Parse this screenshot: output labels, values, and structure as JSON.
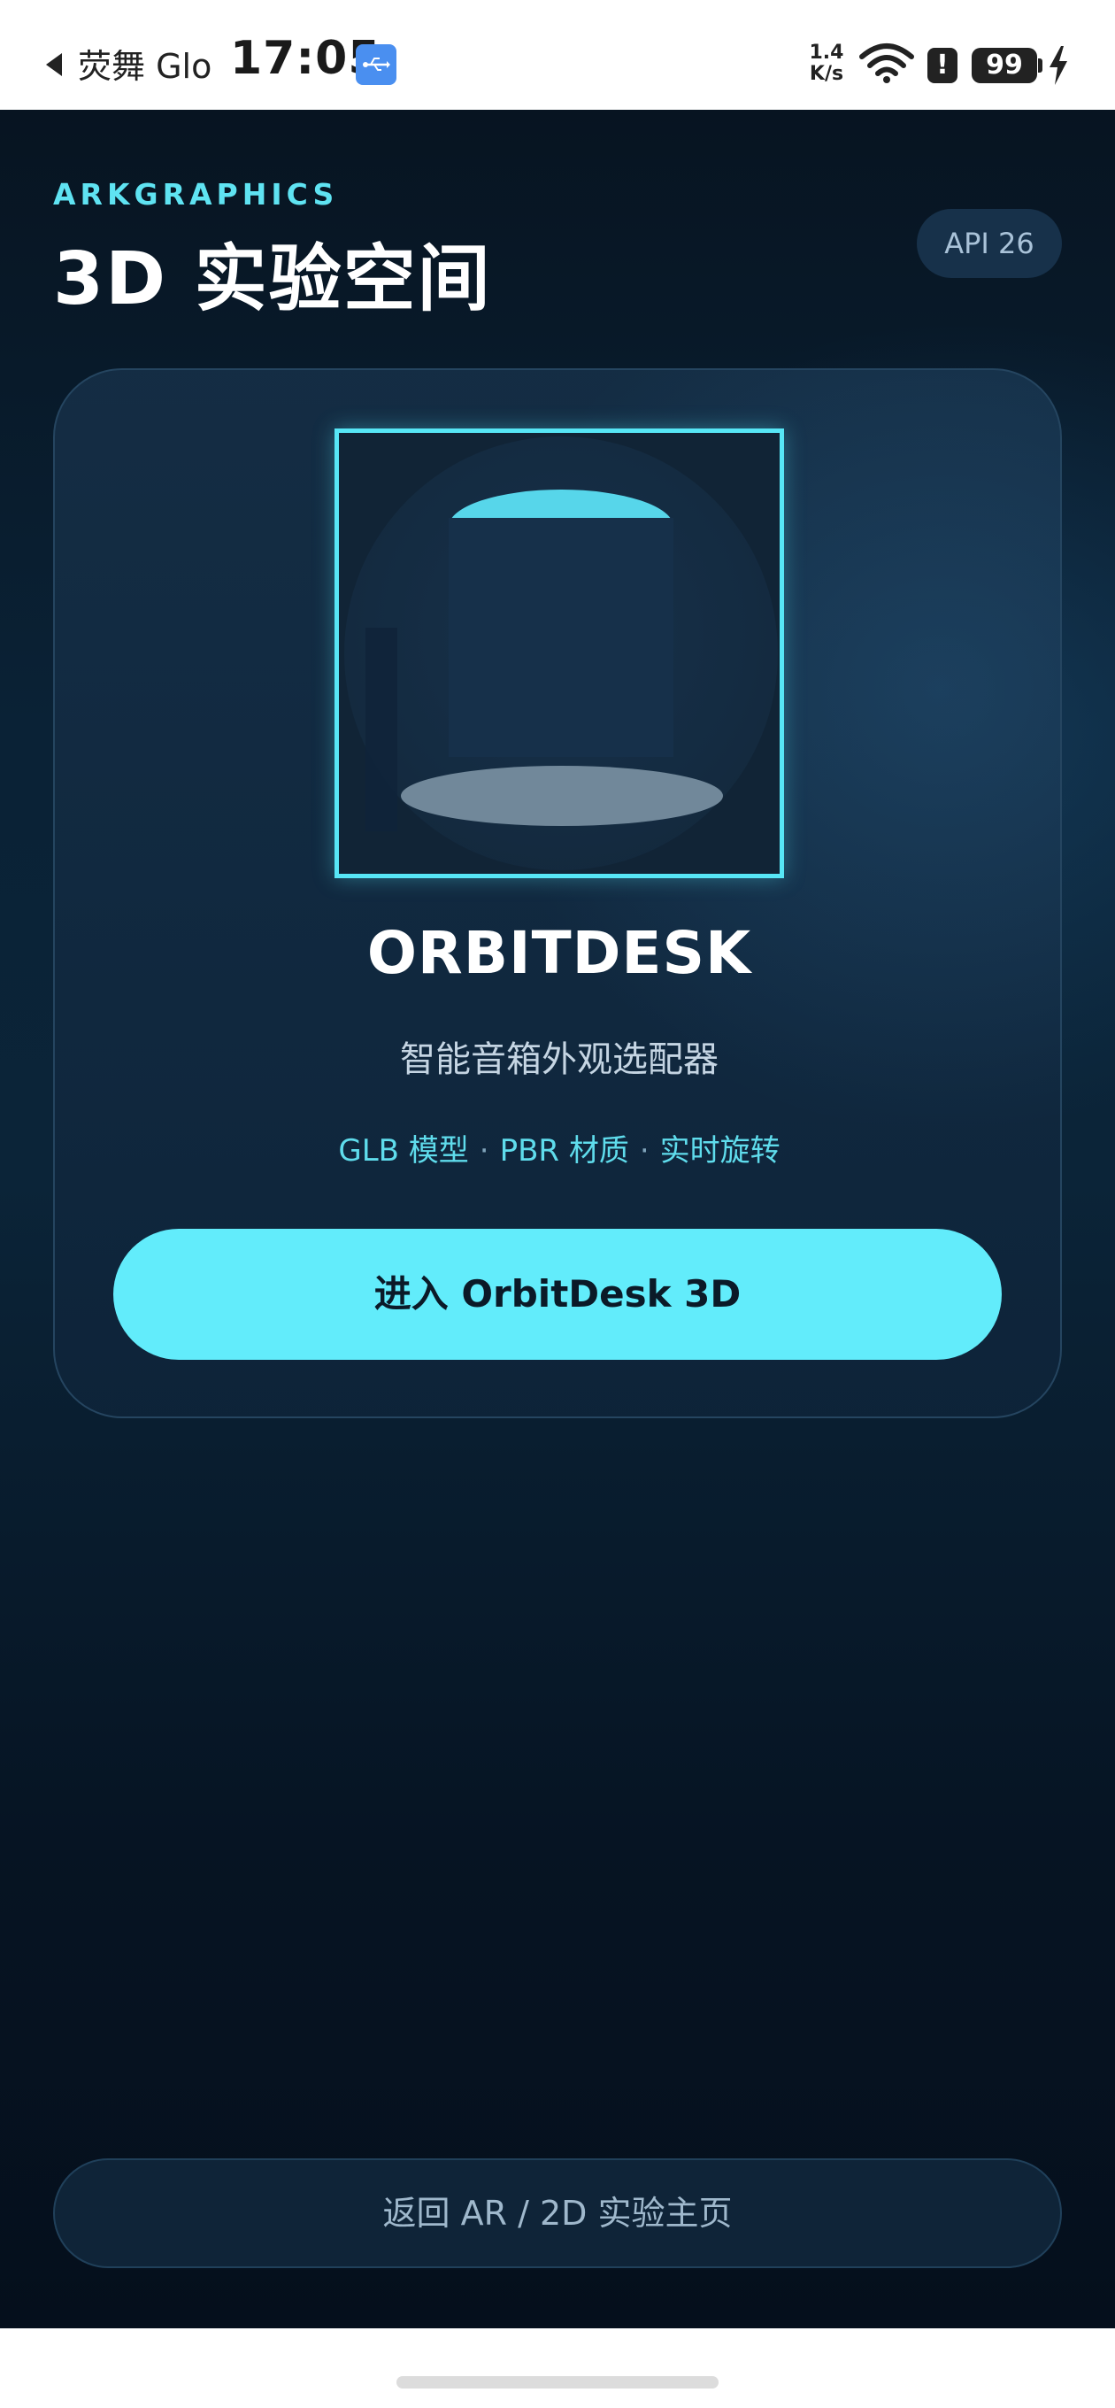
{
  "status_bar": {
    "app_name": "荧舞 Glo",
    "time": "17:05",
    "network_speed": "1.4 K/s",
    "alert_glyph": "!",
    "battery_level": "99",
    "icons": [
      "back-arrow-icon",
      "usb-icon",
      "wifi-icon",
      "alert-icon",
      "battery-icon",
      "charging-icon"
    ]
  },
  "header": {
    "brand": "ARKGRAPHICS",
    "title": "3D 实验空间",
    "api_badge": "API 26"
  },
  "card": {
    "model_name": "ORBITDESK",
    "subtitle": "智能音箱外观选配器",
    "tags": [
      "GLB 模型",
      "PBR 材质",
      "实时旋转"
    ],
    "tag_separator": "·",
    "enter_button": "进入 OrbitDesk 3D"
  },
  "footer": {
    "back_button": "返回 AR / 2D 实验主页"
  },
  "colors": {
    "accent": "#62ecfb",
    "accent_text": "#5fe3f2",
    "background": "#0a2236",
    "model_top": "#57d6ea",
    "model_base": "#71889a"
  }
}
